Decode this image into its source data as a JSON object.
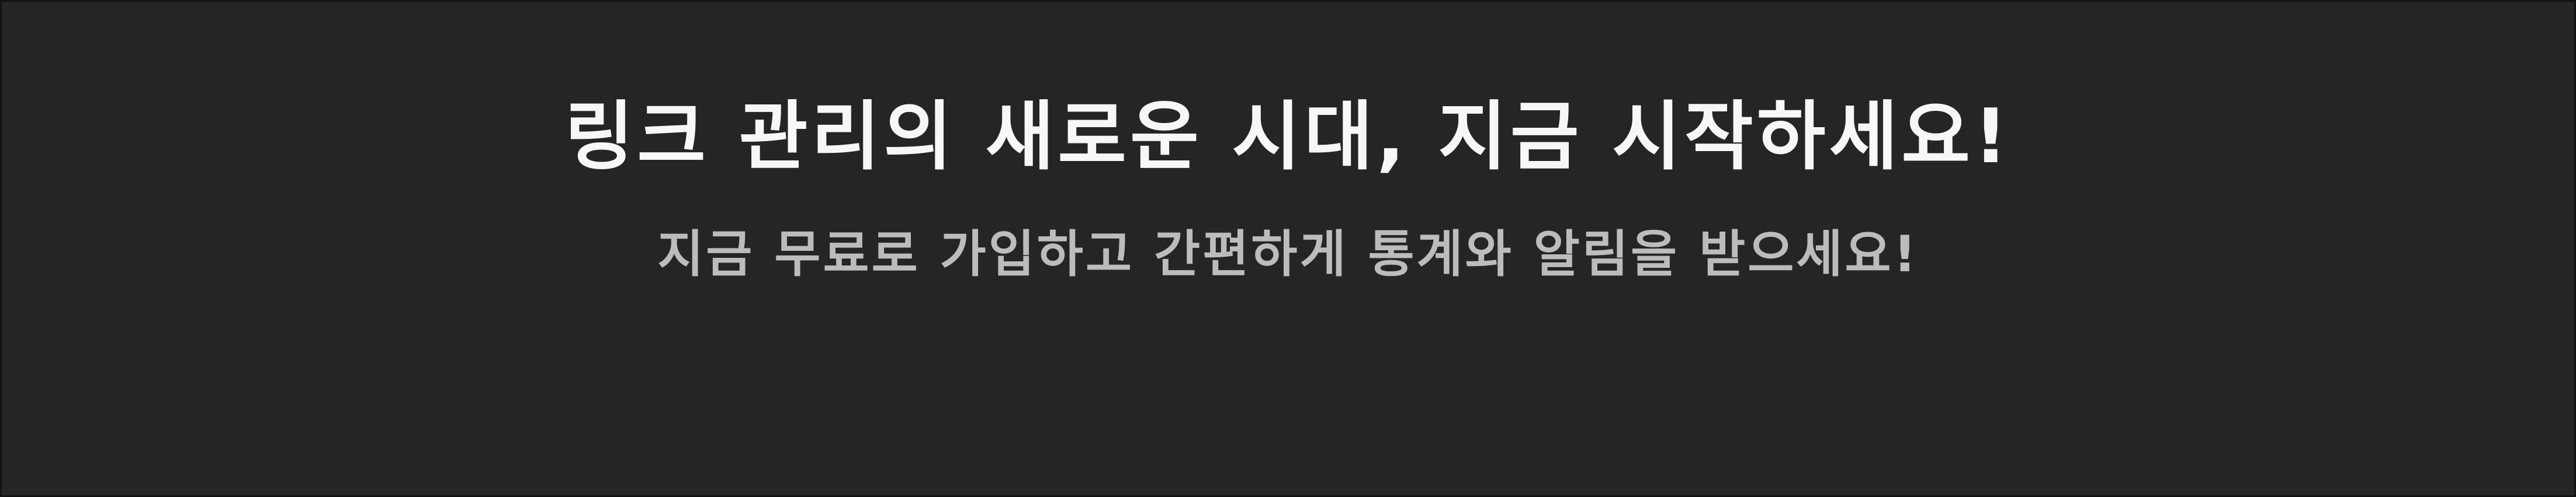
{
  "banner": {
    "headline": "링크 관리의 새로운 시대, 지금 시작하세요!",
    "subline": "지금 무료로 가입하고 간편하게 통계와 알림을 받으세요!",
    "colors": {
      "background": "#252525",
      "border": "#121212",
      "headline": "#f7f7f7",
      "subline": "#bcbcbc"
    }
  }
}
